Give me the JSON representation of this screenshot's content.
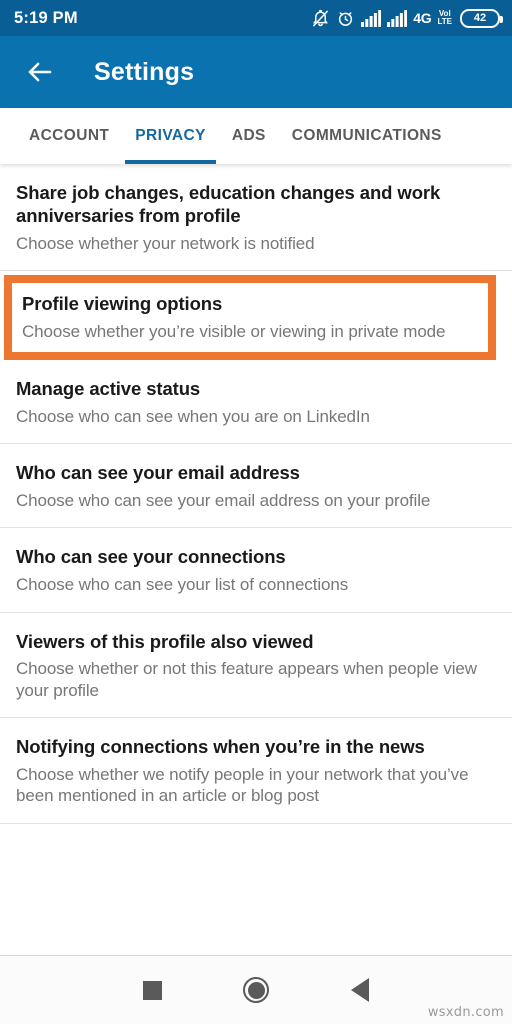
{
  "status_bar": {
    "time": "5:19 PM",
    "icons": [
      "bell-muted-icon",
      "alarm-icon",
      "signal-bars-icon",
      "signal-bars-icon"
    ],
    "network": "4G",
    "network_sub_top": "VoI",
    "network_sub_bottom": "LTE",
    "battery_level": "42",
    "background_color": "#0a5e96"
  },
  "app_bar": {
    "back_icon": "back-arrow-icon",
    "title": "Settings",
    "background_color": "#0b72b0"
  },
  "tabs": {
    "active_index": 1,
    "accent_color": "#16699e",
    "items": [
      {
        "label": "ACCOUNT"
      },
      {
        "label": "PRIVACY"
      },
      {
        "label": "ADS"
      },
      {
        "label": "COMMUNICATIONS"
      }
    ]
  },
  "highlight": {
    "color": "#ed7731",
    "target_index": 1
  },
  "settings_items": [
    {
      "title": "Share job changes, education changes and work anniversaries from profile",
      "subtitle": "Choose whether your network is notified"
    },
    {
      "title": "Profile viewing options",
      "subtitle": "Choose whether you’re visible or viewing in private mode"
    },
    {
      "title": "Manage active status",
      "subtitle": "Choose who can see when you are on LinkedIn"
    },
    {
      "title": "Who can see your email address",
      "subtitle": "Choose who can see your email address on your profile"
    },
    {
      "title": "Who can see your connections",
      "subtitle": "Choose who can see your list of connections"
    },
    {
      "title": "Viewers of this profile also viewed",
      "subtitle": "Choose whether or not this feature appears when people view your profile"
    },
    {
      "title": "Notifying connections when you’re in the news",
      "subtitle": "Choose whether we notify people in your network that you’ve been mentioned in an article or blog post"
    }
  ],
  "nav_bar": {
    "buttons": [
      "recents-square-icon",
      "home-circle-icon",
      "back-triangle-icon"
    ]
  },
  "watermark": "wsxdn.com"
}
